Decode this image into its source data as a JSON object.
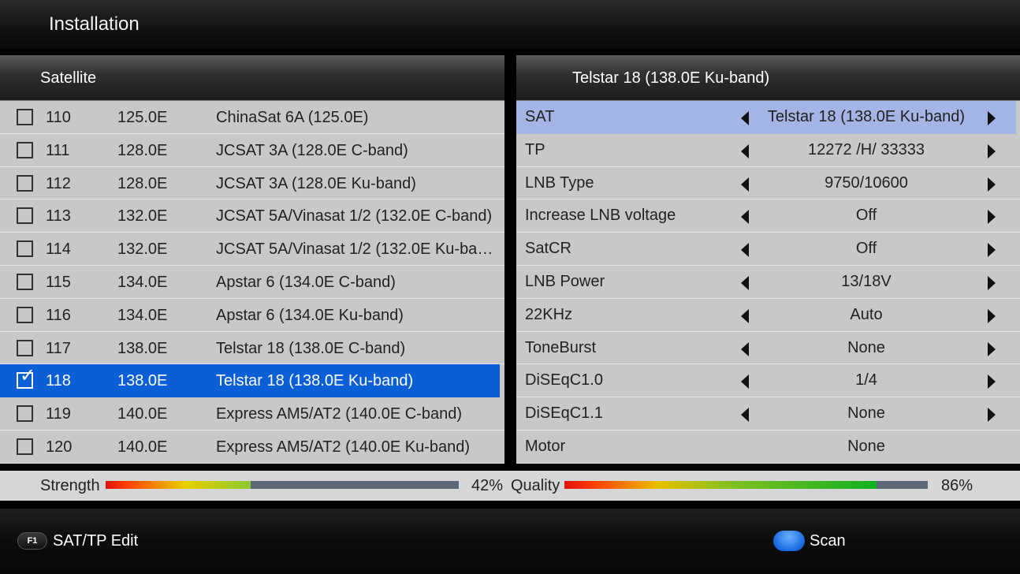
{
  "header": {
    "title": "Installation"
  },
  "left_panel": {
    "title": "Satellite",
    "satellites": [
      {
        "num": "110",
        "pos": "125.0E",
        "name": "ChinaSat 6A (125.0E)",
        "checked": false,
        "selected": false
      },
      {
        "num": "111",
        "pos": "128.0E",
        "name": "JCSAT 3A (128.0E C-band)",
        "checked": false,
        "selected": false
      },
      {
        "num": "112",
        "pos": "128.0E",
        "name": "JCSAT 3A (128.0E Ku-band)",
        "checked": false,
        "selected": false
      },
      {
        "num": "113",
        "pos": "132.0E",
        "name": "JCSAT 5A/Vinasat 1/2 (132.0E C-band)",
        "checked": false,
        "selected": false
      },
      {
        "num": "114",
        "pos": "132.0E",
        "name": "JCSAT 5A/Vinasat 1/2 (132.0E Ku-ban…",
        "checked": false,
        "selected": false
      },
      {
        "num": "115",
        "pos": "134.0E",
        "name": "Apstar 6 (134.0E C-band)",
        "checked": false,
        "selected": false
      },
      {
        "num": "116",
        "pos": "134.0E",
        "name": "Apstar 6 (134.0E Ku-band)",
        "checked": false,
        "selected": false
      },
      {
        "num": "117",
        "pos": "138.0E",
        "name": "Telstar 18 (138.0E C-band)",
        "checked": false,
        "selected": false
      },
      {
        "num": "118",
        "pos": "138.0E",
        "name": "Telstar 18 (138.0E Ku-band)",
        "checked": true,
        "selected": true
      },
      {
        "num": "119",
        "pos": "140.0E",
        "name": "Express AM5/AT2 (140.0E C-band)",
        "checked": false,
        "selected": false
      },
      {
        "num": "120",
        "pos": "140.0E",
        "name": "Express AM5/AT2 (140.0E Ku-band)",
        "checked": false,
        "selected": false
      }
    ]
  },
  "right_panel": {
    "title": "Telstar 18 (138.0E Ku-band)",
    "settings": [
      {
        "label": "SAT",
        "value": "Telstar 18 (138.0E Ku-band)",
        "arrows": true,
        "selected": true
      },
      {
        "label": "TP",
        "value": "12272 /H/ 33333",
        "arrows": true,
        "selected": false
      },
      {
        "label": "LNB Type",
        "value": "9750/10600",
        "arrows": true,
        "selected": false
      },
      {
        "label": "Increase LNB voltage",
        "value": "Off",
        "arrows": true,
        "selected": false
      },
      {
        "label": "SatCR",
        "value": "Off",
        "arrows": true,
        "selected": false
      },
      {
        "label": "LNB Power",
        "value": "13/18V",
        "arrows": true,
        "selected": false
      },
      {
        "label": "22KHz",
        "value": "Auto",
        "arrows": true,
        "selected": false
      },
      {
        "label": "ToneBurst",
        "value": "None",
        "arrows": true,
        "selected": false
      },
      {
        "label": "DiSEqC1.0",
        "value": "1/4",
        "arrows": true,
        "selected": false
      },
      {
        "label": "DiSEqC1.1",
        "value": "None",
        "arrows": true,
        "selected": false
      },
      {
        "label": "Motor",
        "value": "None",
        "arrows": false,
        "selected": false
      }
    ]
  },
  "signal": {
    "strength_label": "Strength",
    "strength_pct": 42,
    "strength_text": "42%",
    "quality_label": "Quality",
    "quality_pct": 86,
    "quality_text": "86%"
  },
  "footer": {
    "f1_key": "F1",
    "f1_label": "SAT/TP Edit",
    "scan_label": "Scan"
  },
  "colors": {
    "selected_row": "#0a5fd6",
    "selected_setting": "#a4b4e4",
    "blue_key": "#1a6ae0"
  }
}
